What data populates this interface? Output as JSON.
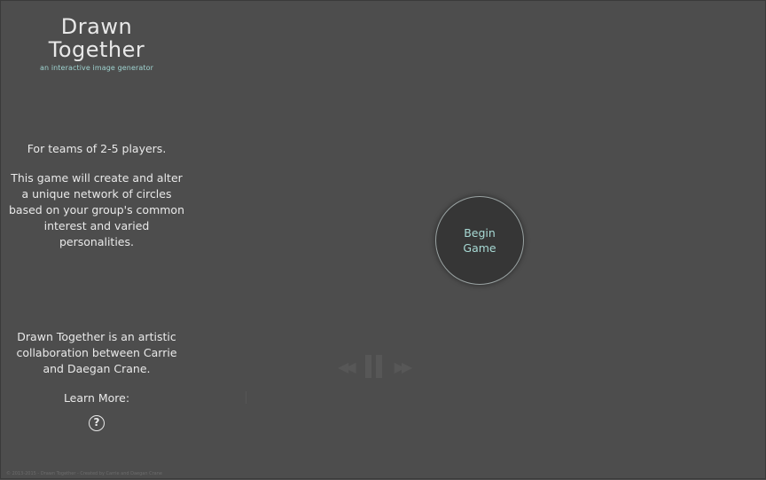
{
  "app": {
    "title": "Drawn Together",
    "subtitle": "an interactive image generator"
  },
  "intro": {
    "players": "For teams of 2-5 players.",
    "description": "This game will create and alter a unique network of circles based on your group's common interest and varied personalities."
  },
  "about": {
    "text": "Drawn Together is an artistic collaboration between Carrie and Daegan Crane.",
    "learn_more": "Learn More:",
    "help_icon": "?"
  },
  "main": {
    "begin_label": "Begin Game"
  },
  "playback": {
    "rewind_icon": "rewind-icon",
    "pause_icon": "pause-icon",
    "forward_icon": "fast-forward-icon"
  },
  "footer": {
    "text": "© 2013-2015 - Drawn Together - Created by Carrie and Daegan Crane"
  },
  "colors": {
    "background": "#4d4d4d",
    "accent": "#a7d9d4",
    "button_fill": "#363636"
  }
}
